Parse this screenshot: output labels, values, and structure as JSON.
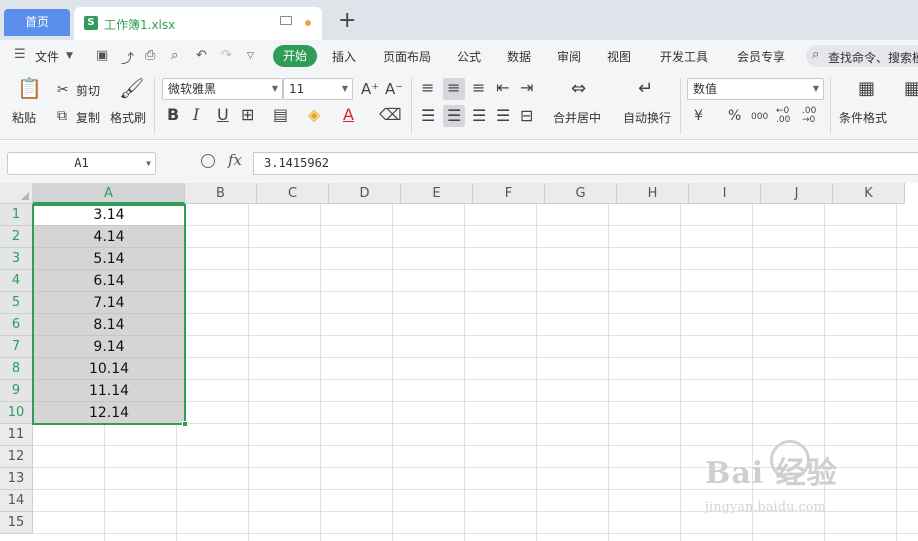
{
  "tabs": {
    "home": "首页",
    "file_logo": "S",
    "file": "工作簿1.xlsx",
    "new": "+"
  },
  "menu": {
    "file": "文件",
    "items": [
      "开始",
      "插入",
      "页面布局",
      "公式",
      "数据",
      "审阅",
      "视图",
      "开发工具",
      "会员专享"
    ],
    "search": "查找命令、搜索模板"
  },
  "toolbar": {
    "paste": "粘贴",
    "cut": "剪切",
    "copy": "复制",
    "format_painter": "格式刷",
    "font_name": "微软雅黑",
    "font_size": "11",
    "merge_center": "合并居中",
    "wrap_text": "自动换行",
    "number_format": "数值",
    "conditional_format": "条件格式",
    "currency": "¥",
    "percent": "%",
    "thousands": "000",
    "inc_decimal": "←0 .00",
    "dec_decimal": ".00 →0"
  },
  "formula_bar": {
    "cell_ref": "A1",
    "fx": "fx",
    "value": "3.1415962"
  },
  "grid": {
    "columns": [
      "A",
      "B",
      "C",
      "D",
      "E",
      "F",
      "G",
      "H",
      "I",
      "J",
      "K"
    ],
    "rows": [
      "1",
      "2",
      "3",
      "4",
      "5",
      "6",
      "7",
      "8",
      "9",
      "10",
      "11",
      "12",
      "13",
      "14",
      "15"
    ],
    "column_a_values": [
      "3.14",
      "4.14",
      "5.14",
      "6.14",
      "7.14",
      "8.14",
      "9.14",
      "10.14",
      "11.14",
      "12.14"
    ]
  },
  "watermark": {
    "brand": "Bai 经验",
    "url": "jingyan.baidu.com"
  },
  "colors": {
    "accent_green": "#2f9d57",
    "home_tab_blue": "#5b8ded"
  }
}
